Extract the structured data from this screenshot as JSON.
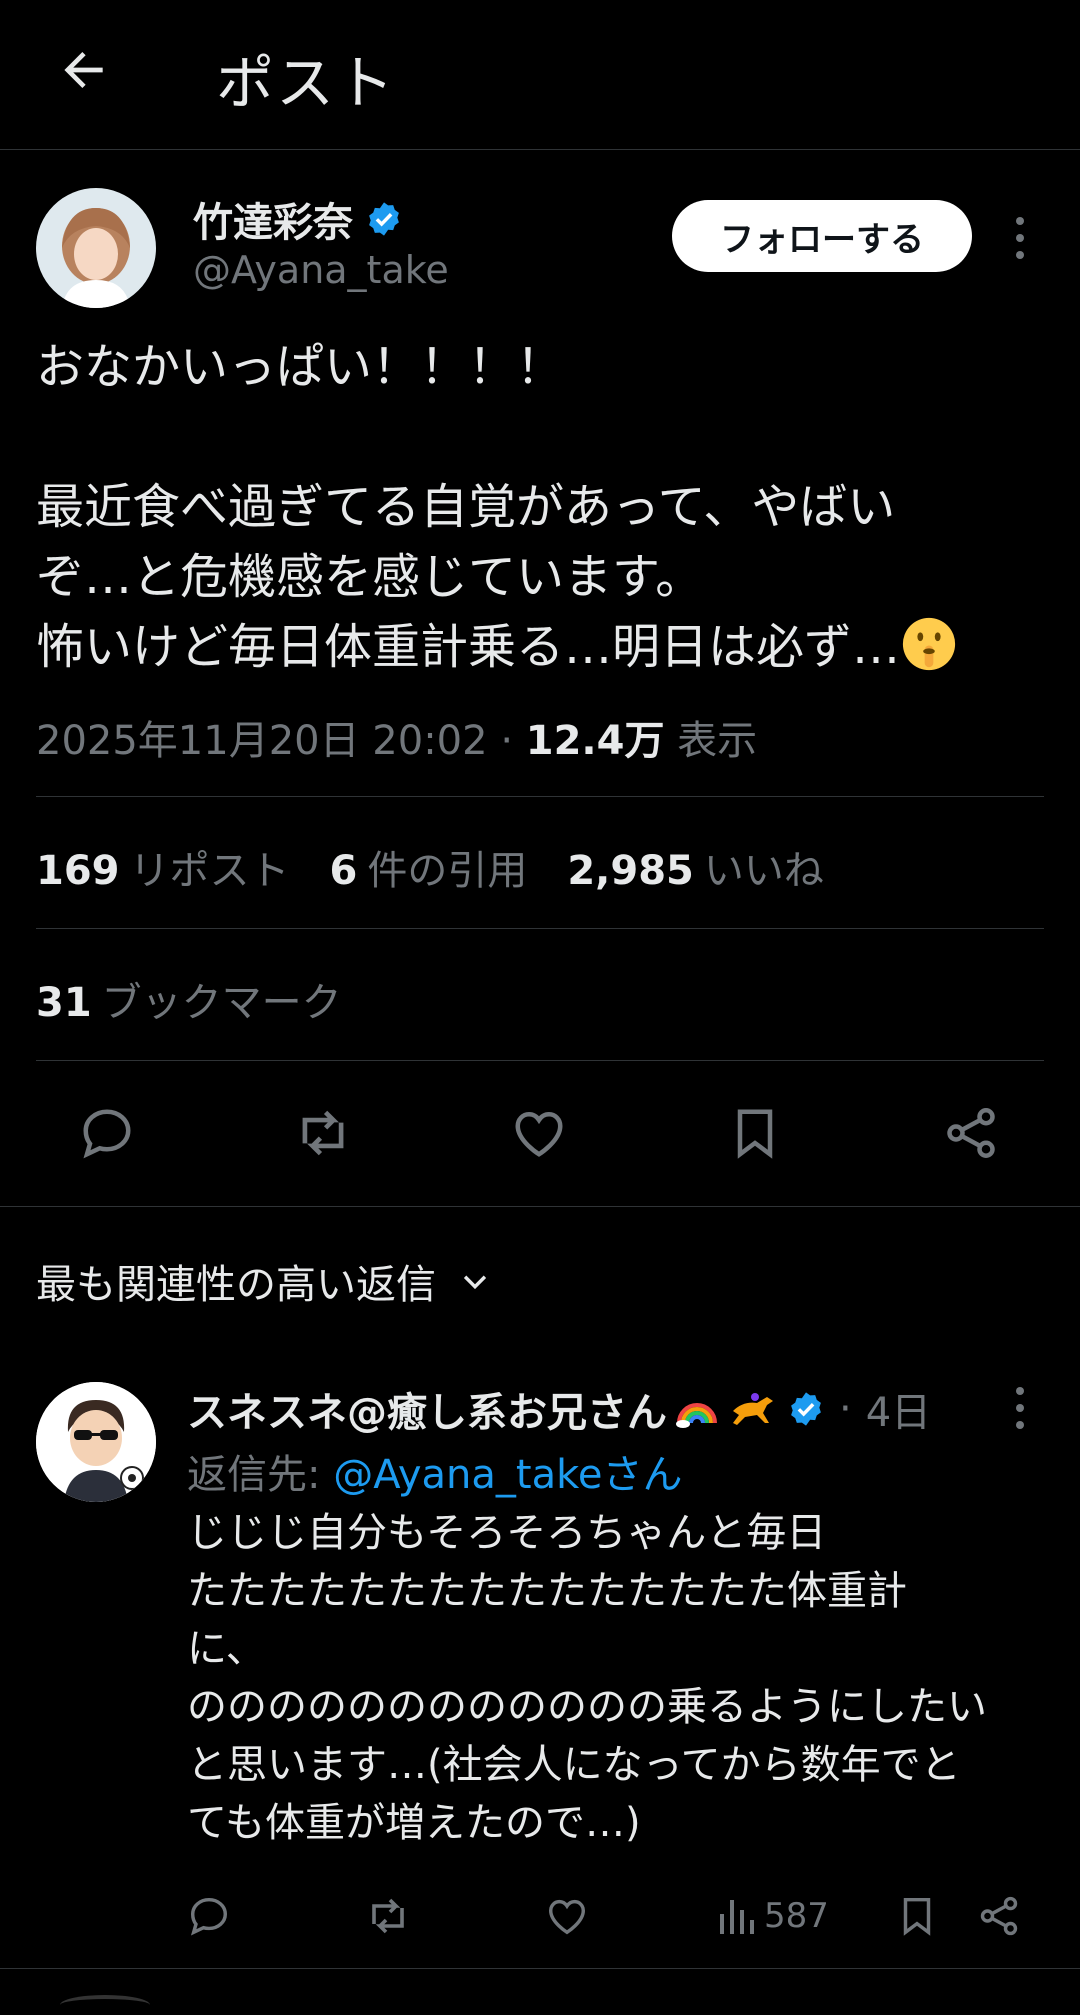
{
  "header": {
    "title": "ポスト",
    "back_icon": "arrow-left-icon"
  },
  "post": {
    "author_name": "竹達彩奈",
    "author_handle": "@Ayana_take",
    "follow_label": "フォローする",
    "body_lines": [
      "おなかいっぱい！！！！",
      "",
      "最近食べ過ぎてる自覚があって、やばい",
      "ぞ…と危機感を感じています。",
      "怖いけど毎日体重計乗る…明日は必ず…"
    ],
    "emoji": "shushing-face-icon",
    "timestamp": "2025年11月20日 20:02",
    "separator": "·",
    "views_count": "12.4万",
    "views_label": "表示"
  },
  "stats": {
    "reposts_count": "169",
    "reposts_label": "リポスト",
    "quotes_count": "6",
    "quotes_label": "件の引用",
    "likes_count": "2,985",
    "likes_label": "いいね",
    "bookmarks_count": "31",
    "bookmarks_label": "ブックマーク"
  },
  "actions": [
    "reply-icon",
    "repost-icon",
    "like-icon",
    "bookmark-icon",
    "share-icon"
  ],
  "replies_sort": {
    "label": "最も関連性の高い返信",
    "icon": "chevron-down-icon"
  },
  "reply": {
    "name": "スネスネ@癒し系お兄さん",
    "name_emojis": [
      "rainbow-icon",
      "horse-racing-icon"
    ],
    "time_sep": "·",
    "time": "4日",
    "replying_prefix": "返信先: ",
    "replying_to": "@Ayana_takeさん",
    "body_lines": [
      "じじじ自分もそろそろちゃんと毎日",
      "たたたたたたたたたたたたたたた体重計",
      "に、",
      "のののののののののののの乗るようにしたい",
      "と思います…(社会人になってから数年でと",
      "ても体重が増えたので…)"
    ],
    "views_count": "587"
  },
  "colors": {
    "accent": "#1d9bf0",
    "background": "#000000",
    "muted": "#71767b",
    "text": "#e7e9ea"
  }
}
